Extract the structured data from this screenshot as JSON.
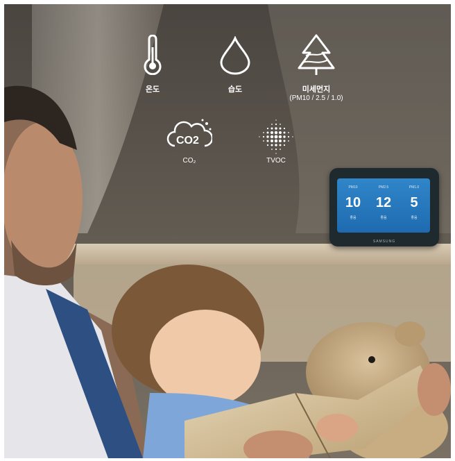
{
  "icons": {
    "temperature": {
      "label": "온도",
      "icon": "thermometer-icon"
    },
    "humidity": {
      "label": "습도",
      "icon": "droplet-icon"
    },
    "fine_dust": {
      "label": "미세먼지",
      "sublabel": "(PM10 / 2.5 / 1.0)",
      "icon": "tree-dust-icon"
    },
    "co2": {
      "label": "CO₂",
      "icon_text": "CO2",
      "icon": "co2-cloud-icon"
    },
    "tvoc": {
      "label": "TVOC",
      "icon": "particles-icon"
    }
  },
  "device": {
    "brand": "SAMSUNG",
    "readings": [
      {
        "label": "PM10",
        "value": "10",
        "grade": "좋음"
      },
      {
        "label": "PM2.5",
        "value": "12",
        "grade": "좋음"
      },
      {
        "label": "PM1.0",
        "value": "5",
        "grade": "좋음"
      }
    ]
  },
  "colors": {
    "screen": "#2b7fc4",
    "icon": "#ffffff"
  }
}
